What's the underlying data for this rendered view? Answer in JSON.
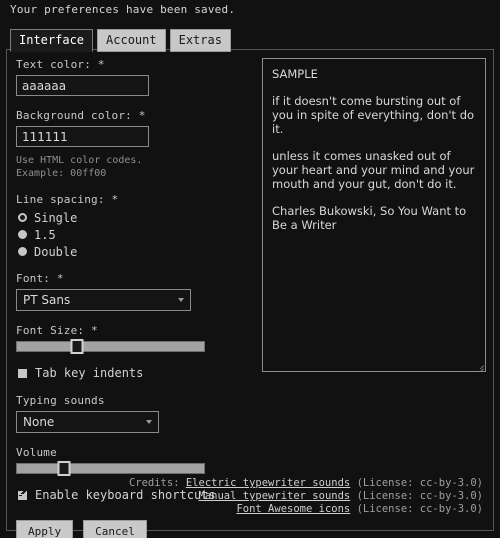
{
  "status_message": "Your preferences have been saved.",
  "tabs": [
    {
      "label": "Interface",
      "active": true
    },
    {
      "label": "Account",
      "active": false
    },
    {
      "label": "Extras",
      "active": false
    }
  ],
  "form": {
    "text_color": {
      "label": "Text color: *",
      "value": "aaaaaa"
    },
    "background_color": {
      "label": "Background color: *",
      "value": "111111",
      "hint_line1": "Use HTML color codes.",
      "hint_line2": "Example: 00ff00"
    },
    "line_spacing": {
      "label": "Line spacing: *",
      "options": [
        {
          "label": "Single",
          "checked": true
        },
        {
          "label": "1.5",
          "checked": false
        },
        {
          "label": "Double",
          "checked": false
        }
      ]
    },
    "font": {
      "label": "Font: *",
      "value": "PT Sans"
    },
    "font_size": {
      "label": "Font Size: *",
      "percent": 32
    },
    "tab_key_indents": {
      "label": "Tab key indents",
      "checked": false
    },
    "typing_sounds": {
      "label": "Typing sounds",
      "value": "None"
    },
    "volume": {
      "label": "Volume",
      "percent": 25
    },
    "keyboard_shortcuts": {
      "label": "Enable keyboard shortcuts",
      "checked": true
    },
    "apply_label": "Apply",
    "cancel_label": "Cancel"
  },
  "sample": {
    "heading": "SAMPLE",
    "paragraph1": "if it doesn't come bursting out of you in spite of everything, don't do it.",
    "paragraph2": "unless it comes unasked out of your heart and your mind and your mouth and your gut, don't do it.",
    "attribution": "Charles Bukowski, So You Want to Be a Writer"
  },
  "credits": {
    "lead": "Credits:",
    "items": [
      {
        "link": "Electric typewriter sounds",
        "license": "(License: cc-by-3.0)"
      },
      {
        "link": "Manual typewriter sounds",
        "license": "(License: cc-by-3.0)"
      },
      {
        "link": "Font Awesome icons",
        "license": "(License: cc-by-3.0)"
      }
    ]
  },
  "colors": {
    "page_bg": "#111111",
    "text": "#aaaaaa",
    "control_light": "#c9c9c9",
    "border": "#8a8a8a"
  }
}
